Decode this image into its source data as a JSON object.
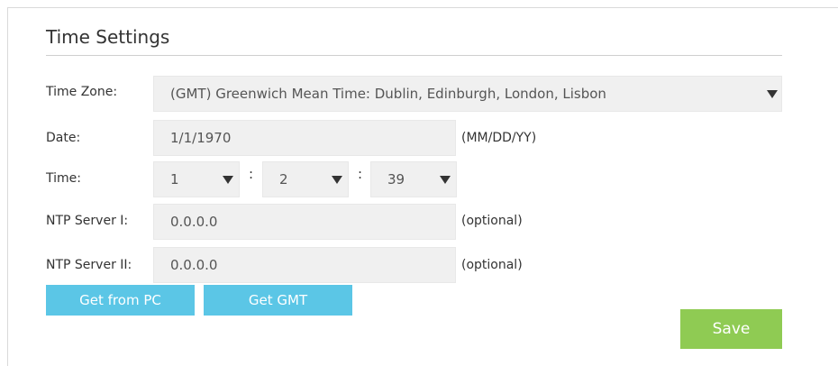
{
  "section": {
    "title": "Time Settings"
  },
  "time_zone": {
    "label": "Time Zone:",
    "selected": "(GMT) Greenwich Mean Time: Dublin, Edinburgh, London, Lisbon"
  },
  "date": {
    "label": "Date:",
    "value": "1/1/1970",
    "format_hint": "(MM/DD/YY)"
  },
  "time": {
    "label": "Time:",
    "hour": "1",
    "minute": "2",
    "second": "39",
    "separator": ":"
  },
  "ntp1": {
    "label": "NTP Server I:",
    "value": "0.0.0.0",
    "hint": "(optional)"
  },
  "ntp2": {
    "label": "NTP Server II:",
    "value": "0.0.0.0",
    "hint": "(optional)"
  },
  "buttons": {
    "get_from_pc": "Get from PC",
    "get_gmt": "Get GMT",
    "save": "Save"
  },
  "colors": {
    "button_blue": "#5bc6e6",
    "button_green": "#8fcb53",
    "field_background": "#f0f0f0"
  },
  "icons": {
    "dropdown": "caret-down-icon"
  }
}
